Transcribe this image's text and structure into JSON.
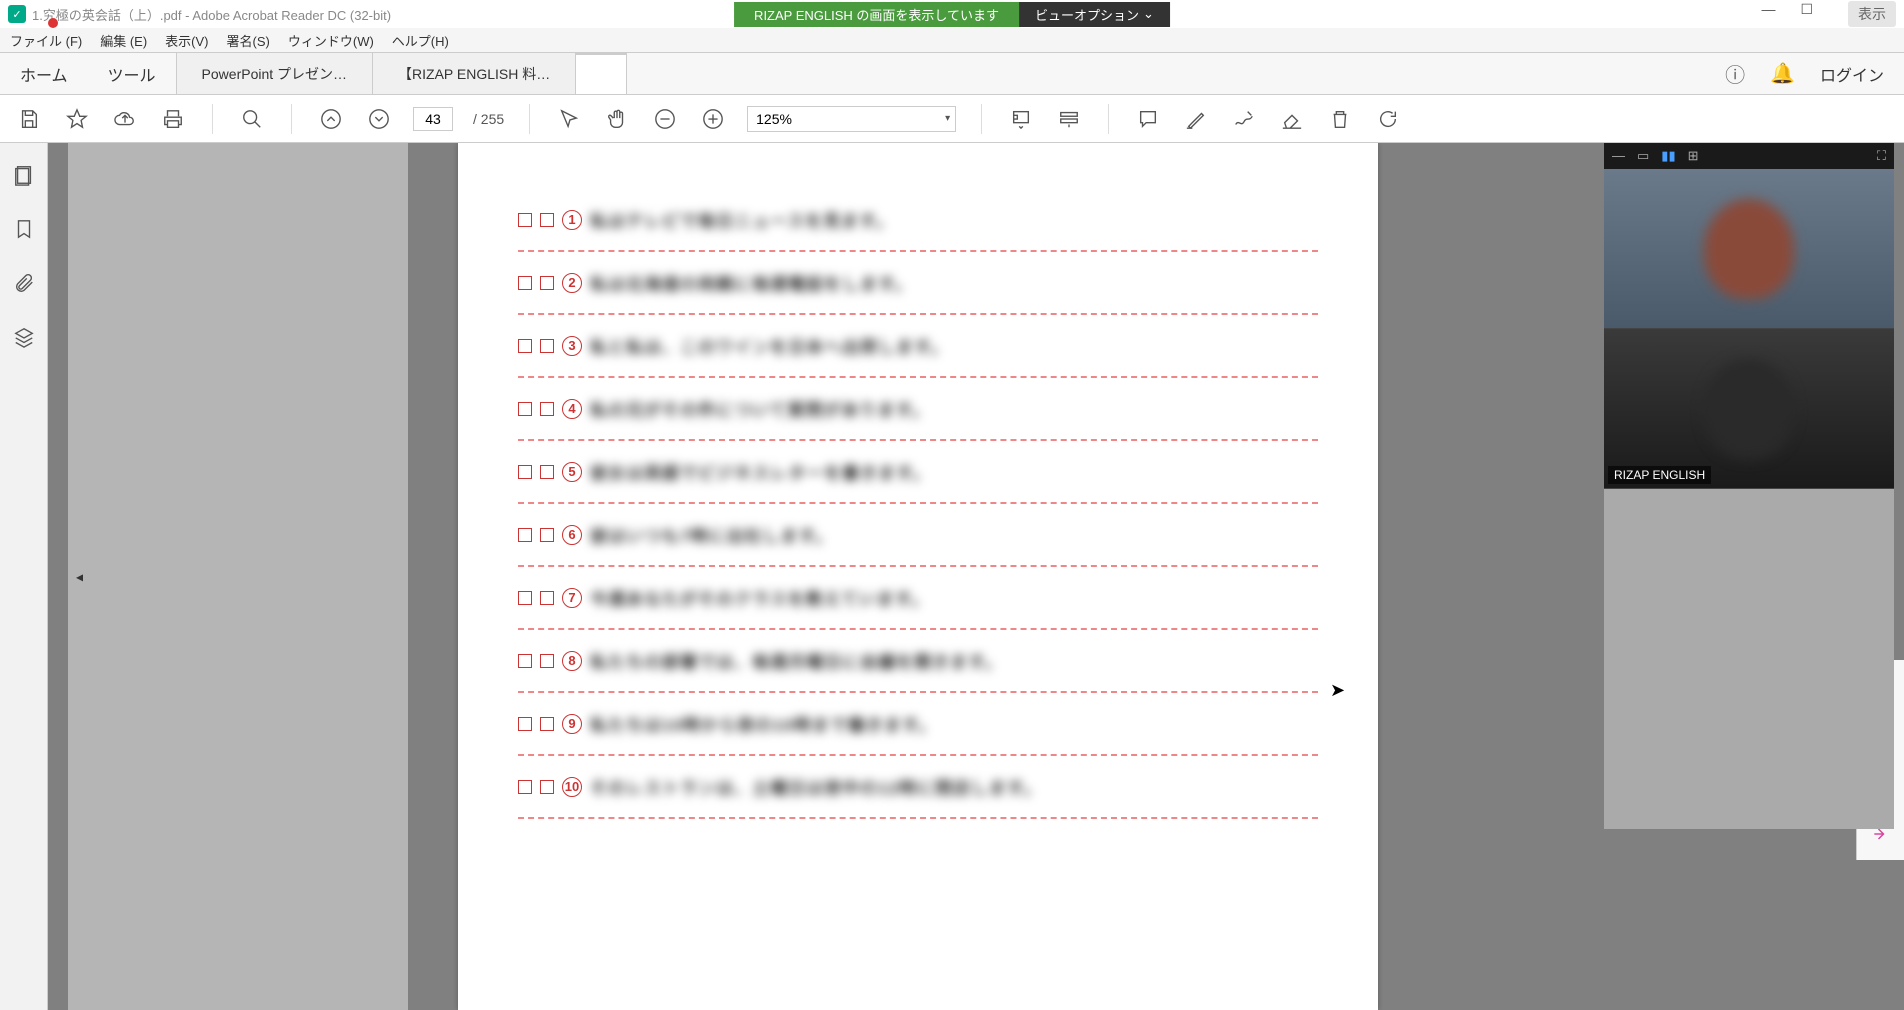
{
  "window": {
    "title": "1.究極の英会話（上）.pdf - Adobe Acrobat Reader DC (32-bit)",
    "banner_green": "RIZAP ENGLISH の画面を表示しています",
    "banner_dark": "ビューオプション",
    "display_btn": "表示"
  },
  "menu": {
    "file": "ファイル (F)",
    "edit": "編集 (E)",
    "view": "表示(V)",
    "sign": "署名(S)",
    "window": "ウィンドウ(W)",
    "help": "ヘルプ(H)"
  },
  "tabs": {
    "home": "ホーム",
    "tools": "ツール",
    "login": "ログイン",
    "docs": [
      {
        "label": "PowerPoint プレゼン…"
      },
      {
        "label": "【RIZAP ENGLISH 料…"
      },
      {
        "label": ""
      }
    ]
  },
  "toolbar": {
    "page_current": "43",
    "page_sep": "/",
    "page_total": "255",
    "zoom": "125%"
  },
  "document": {
    "questions": [
      {
        "n": "1",
        "text": "私はテレビで毎日ニュースを見ます。"
      },
      {
        "n": "2",
        "text": "私は北海道の両親に毎週電話をします。"
      },
      {
        "n": "3",
        "text": "私と私は、このワインを日本へ出荷します。"
      },
      {
        "n": "4",
        "text": "私の兄がその件について質問があります。"
      },
      {
        "n": "5",
        "text": "彼女は英語でビジネスレターを書きます。"
      },
      {
        "n": "6",
        "text": "彼はいつも7時に出社します。"
      },
      {
        "n": "7",
        "text": "今週あなたがそのクラスを教えています。"
      },
      {
        "n": "8",
        "text": "私たちの部署では、毎週月曜日に会議を開きます。"
      },
      {
        "n": "9",
        "text": "私たちは10時から夜の10時まで働きます。"
      },
      {
        "n": "10",
        "text": "そのレストランは、土曜日は夜中の12時に閉店します。"
      }
    ]
  },
  "video": {
    "participant2_label": "RIZAP ENGLISH"
  }
}
